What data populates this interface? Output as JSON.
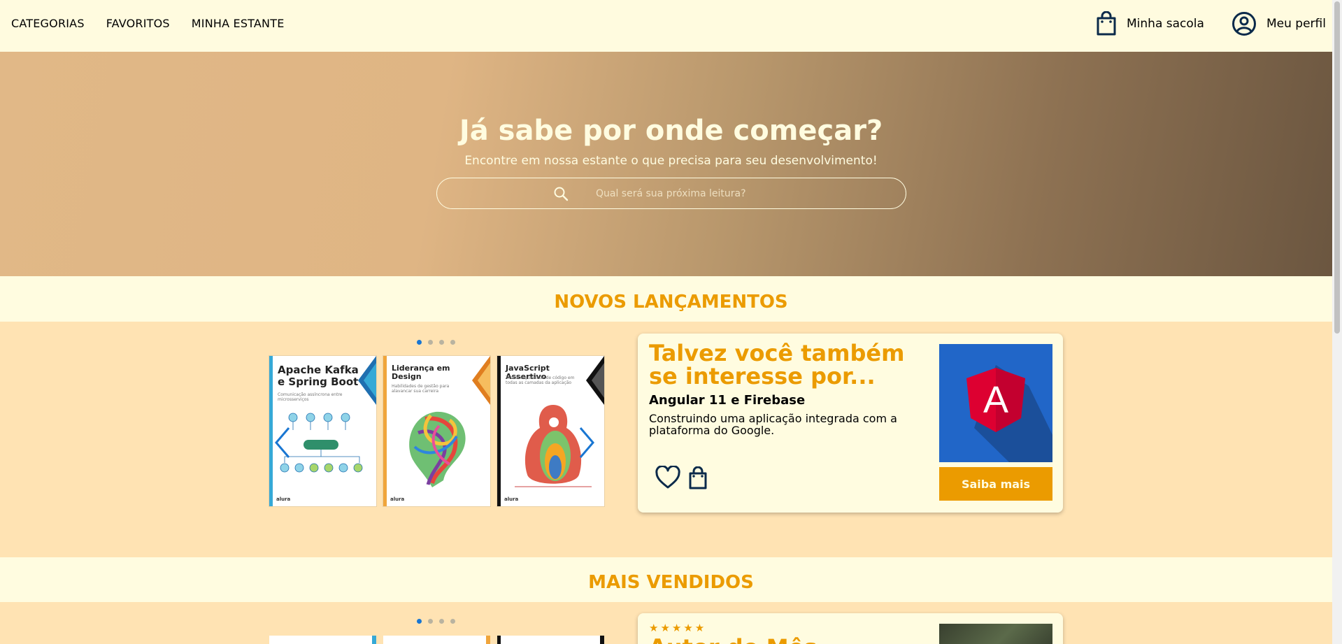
{
  "header": {
    "nav": [
      "CATEGORIAS",
      "FAVORITOS",
      "MINHA ESTANTE"
    ],
    "bag_label": "Minha sacola",
    "profile_label": "Meu perfil"
  },
  "hero": {
    "title": "Já sabe por onde começar?",
    "subtitle": "Encontre em nossa estante o que precisa para seu desenvolvimento!",
    "search_placeholder": "Qual será sua próxima leitura?"
  },
  "new_releases": {
    "title": "NOVOS LANÇAMENTOS",
    "carousel": {
      "dots": 4,
      "active_dot": 0,
      "books": [
        {
          "title": "Apache Kafka e Spring Boot",
          "subtitle": "Comunicação assíncrona entre microsserviços",
          "publisher": "alura"
        },
        {
          "title": "Liderança em Design",
          "subtitle": "Habilidades de gestão para alavancar sua carreira",
          "publisher": "alura"
        },
        {
          "title": "JavaScript Assertivo",
          "subtitle": "Testes e qualidade de código em todas as camadas da aplicação",
          "publisher": "alura"
        }
      ]
    },
    "suggestion": {
      "heading": "Talvez você também se interesse por...",
      "book_title": "Angular 11 e Firebase",
      "book_description": "Construindo uma aplicação integrada com a plataforma do Google.",
      "cover_letter": "A",
      "button_label": "Saiba mais"
    }
  },
  "best_sellers": {
    "title": "MAIS VENDIDOS",
    "carousel": {
      "dots": 4,
      "active_dot": 0
    },
    "card": {
      "stars": "★★★★★",
      "heading": "Autor do Mês"
    }
  },
  "colors": {
    "accent": "#EB9B00",
    "background": "#FFFCE0",
    "band": "#FFE3B3",
    "active_dot": "#1976D2"
  },
  "icons": [
    "search-icon",
    "bag-icon",
    "profile-icon",
    "heart-icon",
    "chevron-left-icon",
    "chevron-right-icon"
  ]
}
